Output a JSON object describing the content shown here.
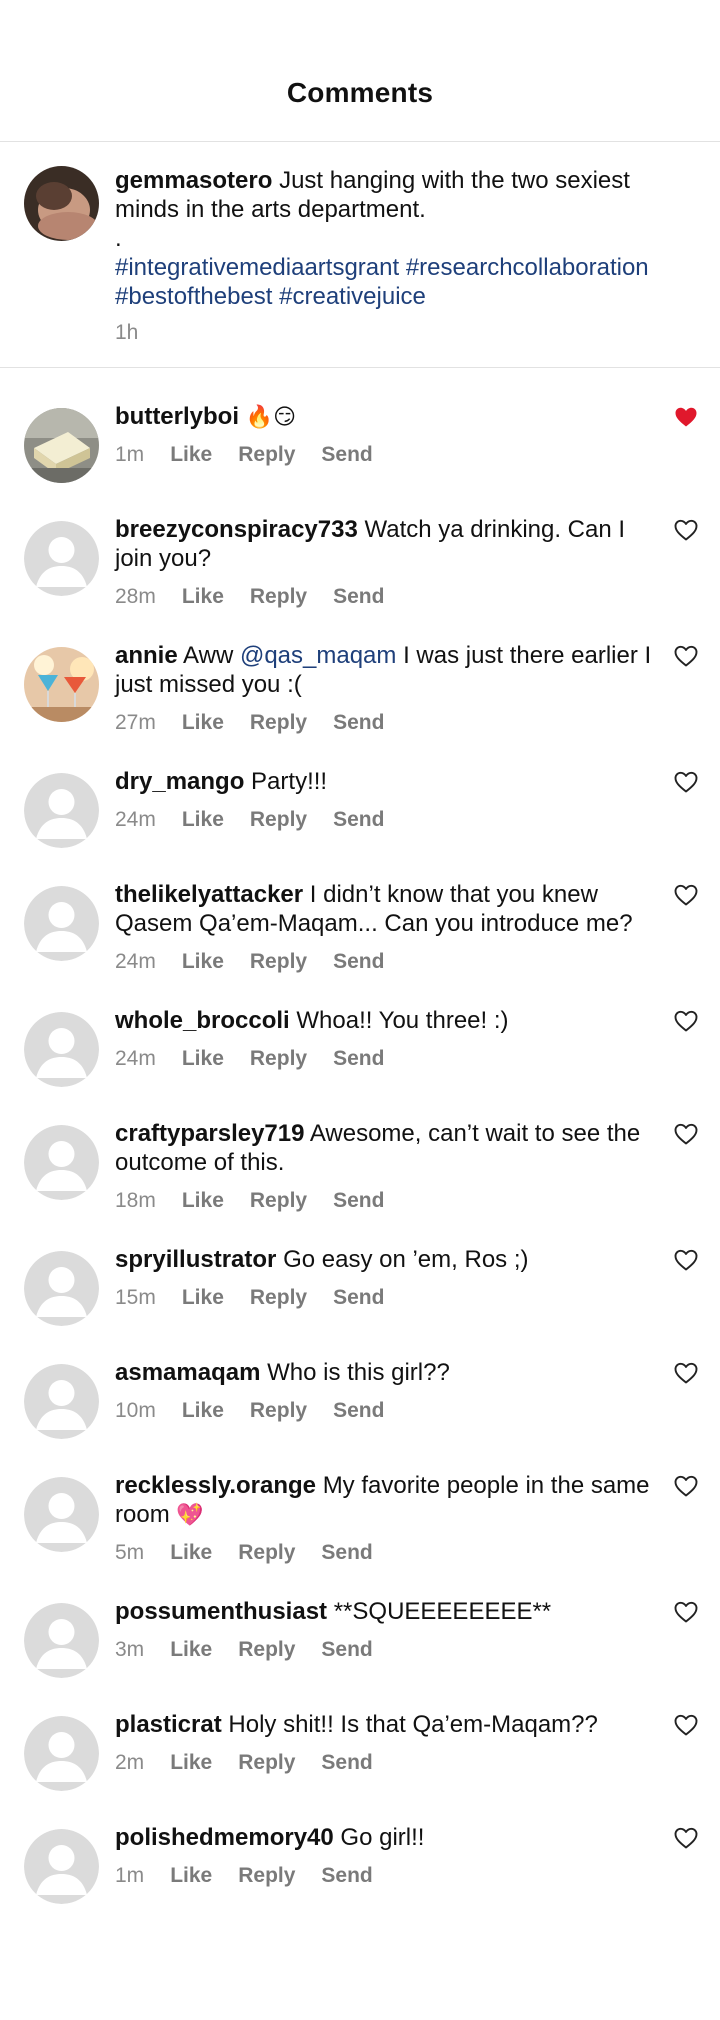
{
  "header": {
    "title": "Comments"
  },
  "caption": {
    "username": "gemmasotero",
    "text": "Just hanging with the two sexiest minds in the arts department.",
    "dot": ".",
    "tags": [
      "#integrativemediaartsgrant",
      "#researchcollaboration",
      "#bestofthebest",
      "#creativejuice"
    ],
    "time": "1h"
  },
  "actions": {
    "like": "Like",
    "reply": "Reply",
    "send": "Send"
  },
  "colors": {
    "liked": "#e0182c",
    "link": "#1e3f7a",
    "meta": "#8a8a8a"
  },
  "comments": [
    {
      "username": "butterlyboi",
      "text": "",
      "emoji": "🔥😏",
      "time": "1m",
      "liked": true,
      "avatar": "photo-cake"
    },
    {
      "username": "breezyconspiracy733",
      "text": "Watch ya drinking. Can I join you?",
      "time": "28m",
      "liked": false,
      "avatar": "default"
    },
    {
      "username": "annie",
      "pre": "Aww",
      "mention": "@qas_maqam",
      "text": "I was just there earlier I just missed you :(",
      "time": "27m",
      "liked": false,
      "avatar": "photo-drinks"
    },
    {
      "username": "dry_mango",
      "text": "Party!!!",
      "time": "24m",
      "liked": false,
      "avatar": "default"
    },
    {
      "username": "thelikelyattacker",
      "text": "I didn’t know that you knew Qasem Qa’em-Maqam... Can you introduce me?",
      "time": "24m",
      "liked": false,
      "avatar": "default"
    },
    {
      "username": "whole_broccoli",
      "text": "Whoa!! You three! :)",
      "time": "24m",
      "liked": false,
      "avatar": "default"
    },
    {
      "username": "craftyparsley719",
      "text": "Awesome, can’t wait to see the outcome of this.",
      "time": "18m",
      "liked": false,
      "avatar": "default"
    },
    {
      "username": "spryillustrator",
      "text": "Go easy on ’em, Ros ;)",
      "time": "15m",
      "liked": false,
      "avatar": "default"
    },
    {
      "username": "asmamaqam",
      "text": "Who is this girl??",
      "time": "10m",
      "liked": false,
      "avatar": "default"
    },
    {
      "username": "recklessly.orange",
      "text": "My favorite people in the same room",
      "emoji": "💖",
      "time": "5m",
      "liked": false,
      "avatar": "default"
    },
    {
      "username": "possumenthusiast",
      "text": "**SQUEEEEEEEE**",
      "time": "3m",
      "liked": false,
      "avatar": "default"
    },
    {
      "username": "plasticrat",
      "text": "Holy shit!! Is that Qa’em-Maqam??",
      "time": "2m",
      "liked": false,
      "avatar": "default"
    },
    {
      "username": "polishedmemory40",
      "text": "Go girl!!",
      "time": "1m",
      "liked": false,
      "avatar": "default"
    }
  ]
}
